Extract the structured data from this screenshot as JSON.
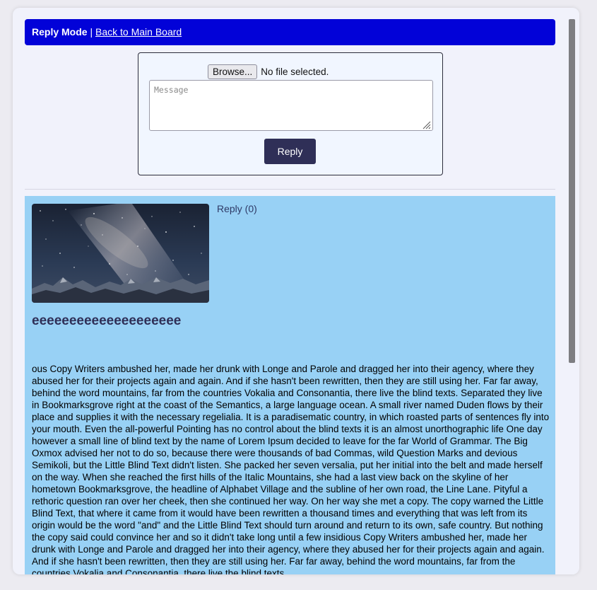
{
  "topbar": {
    "mode_label": "Reply Mode",
    "separator": " | ",
    "back_link": "Back to Main Board",
    "background": "#0202d8"
  },
  "form": {
    "browse_label": "Browse...",
    "file_status": "No file selected.",
    "message_placeholder": "Message",
    "message_value": "",
    "submit_label": "Reply",
    "submit_color": "#2f2f57"
  },
  "post": {
    "background": "#98d1f5",
    "image_alt": "starry night sky with milky way over mountains",
    "reply_link": "Reply (0)",
    "title": "eeeeeeeeeeeeeeeeeeee",
    "body": "ous Copy Writers ambushed her, made her drunk with Longe and Parole and dragged her into their agency, where they abused her for their projects again and again. And if she hasn't been rewritten, then they are still using her. Far far away, behind the word mountains, far from the countries Vokalia and Consonantia, there live the blind texts. Separated they live in Bookmarksgrove right at the coast of the Semantics, a large language ocean. A small river named Duden flows by their place and supplies it with the necessary regelialia. It is a paradisematic country, in which roasted parts of sentences fly into your mouth. Even the all-powerful Pointing has no control about the blind texts it is an almost unorthographic life One day however a small line of blind text by the name of Lorem Ipsum decided to leave for the far World of Grammar. The Big Oxmox advised her not to do so, because there were thousands of bad Commas, wild Question Marks and devious Semikoli, but the Little Blind Text didn't listen. She packed her seven versalia, put her initial into the belt and made herself on the way. When she reached the first hills of the Italic Mountains, she had a last view back on the skyline of her hometown Bookmarksgrove, the headline of Alphabet Village and the subline of her own road, the Line Lane. Pityful a rethoric question ran over her cheek, then she continued her way. On her way she met a copy. The copy warned the Little Blind Text, that where it came from it would have been rewritten a thousand times and everything that was left from its origin would be the word \"and\" and the Little Blind Text should turn around and return to its own, safe country. But nothing the copy said could convince her and so it didn't take long until a few insidious Copy Writers ambushed her, made her drunk with Longe and Parole and dragged her into their agency, where they abused her for their projects again and again. And if she hasn't been rewritten, then they are still using her. Far far away, behind the word mountains, far from the countries Vokalia and Consonantia, there live the blind texts."
  },
  "icons": {
    "resize_grip": "resize-grip-icon",
    "post_image": "night-sky-image"
  }
}
